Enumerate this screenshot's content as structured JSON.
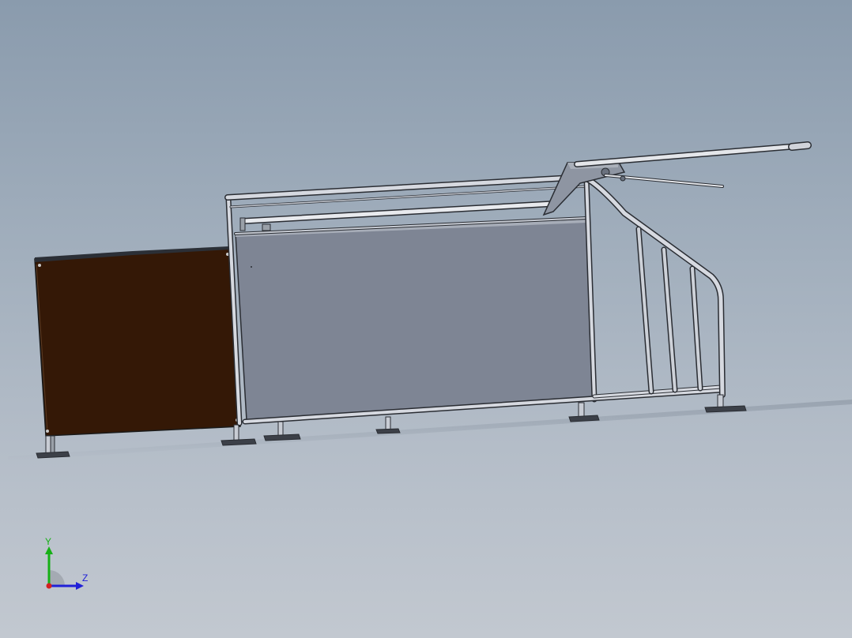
{
  "scene": {
    "model_name": "",
    "colors": {
      "background_top": "#8a9bad",
      "background_bottom": "#c2c8d0",
      "brown_panel": "#341806",
      "grey_panel": "#7e8594",
      "frame_light": "#d6d9e0",
      "frame_dark": "#2a2d33",
      "axis_x": "#d42020",
      "axis_y": "#16b016",
      "axis_z": "#2020d8"
    }
  },
  "triad": {
    "y_label": "Y",
    "z_label": "Z"
  }
}
